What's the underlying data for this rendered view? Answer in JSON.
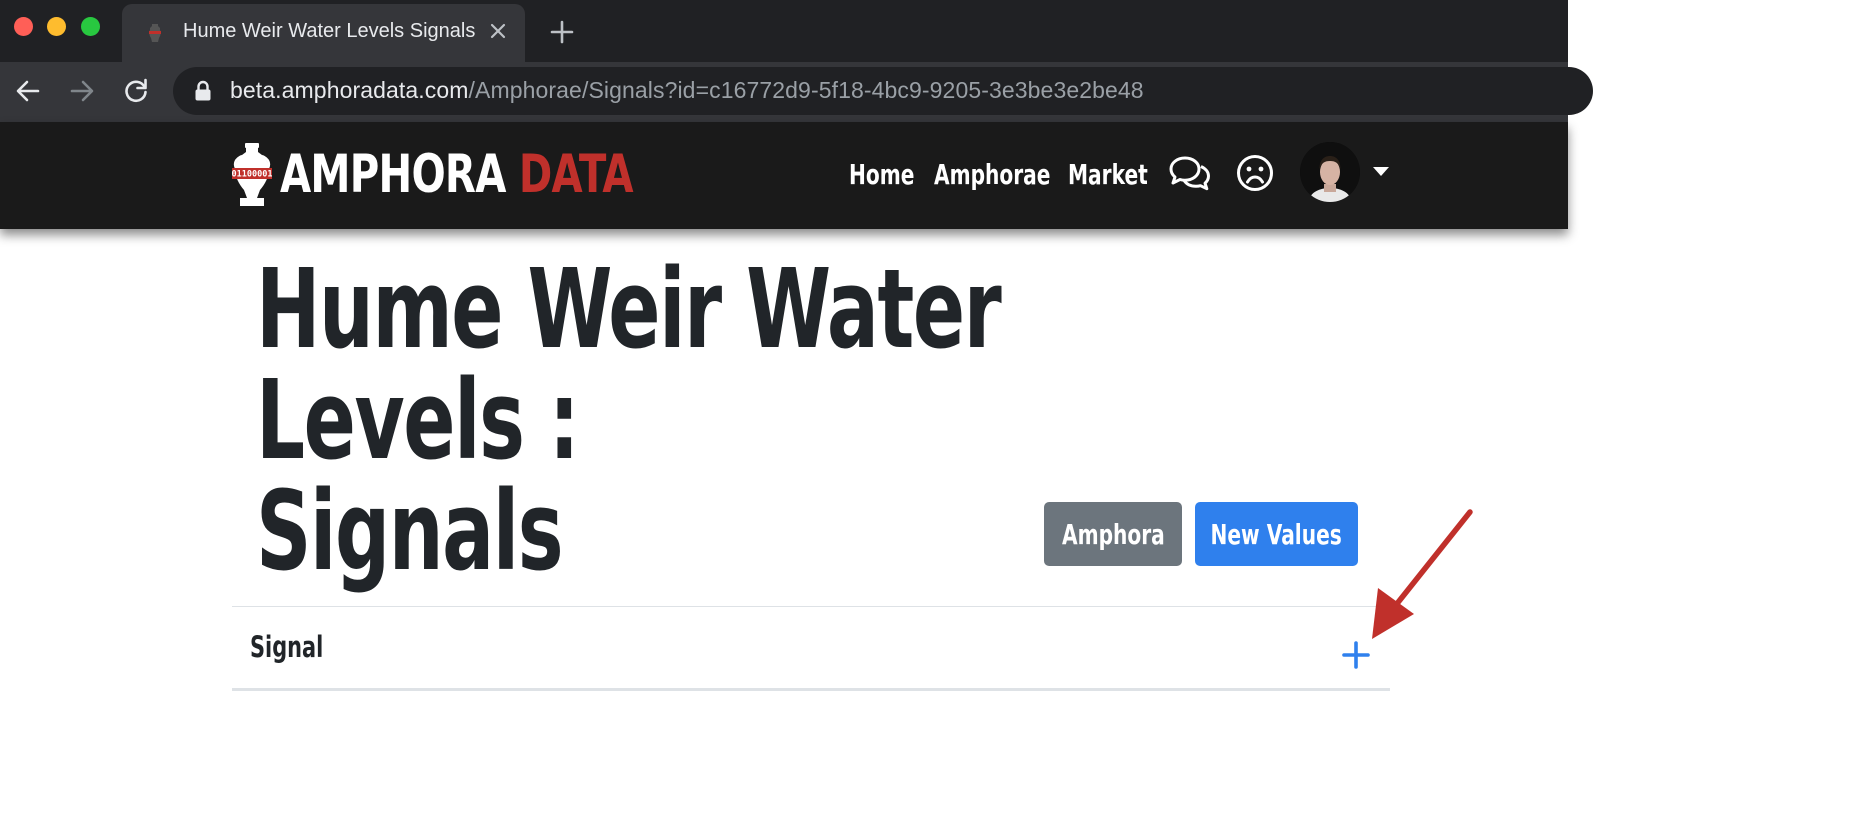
{
  "browser": {
    "tab_title": "Hume Weir Water Levels Signals",
    "url_host": "beta.amphoradata.com",
    "url_path": "/Amphorae/Signals?id=c16772d9-5f18-4bc9-9205-3e3be3e2be48"
  },
  "site": {
    "brand_primary": "AMPHORA",
    "brand_secondary": "DATA",
    "logo_binary": "01100001",
    "nav": [
      "Home",
      "Amphorae",
      "Market"
    ],
    "icons": [
      "chat-icon",
      "sad-face-icon"
    ],
    "colors": {
      "navbar": "#1a1a1a",
      "brand_red": "#c0302b"
    }
  },
  "page": {
    "title_line1": "Hume Weir Water Levels :",
    "title_line2": "Signals",
    "buttons": {
      "amphora": "Amphora",
      "new_values": "New Values"
    },
    "table": {
      "header": "Signal"
    },
    "colors": {
      "primary": "#2f80ed",
      "secondary": "#6c757d",
      "annotation_arrow": "#c0302b"
    }
  }
}
